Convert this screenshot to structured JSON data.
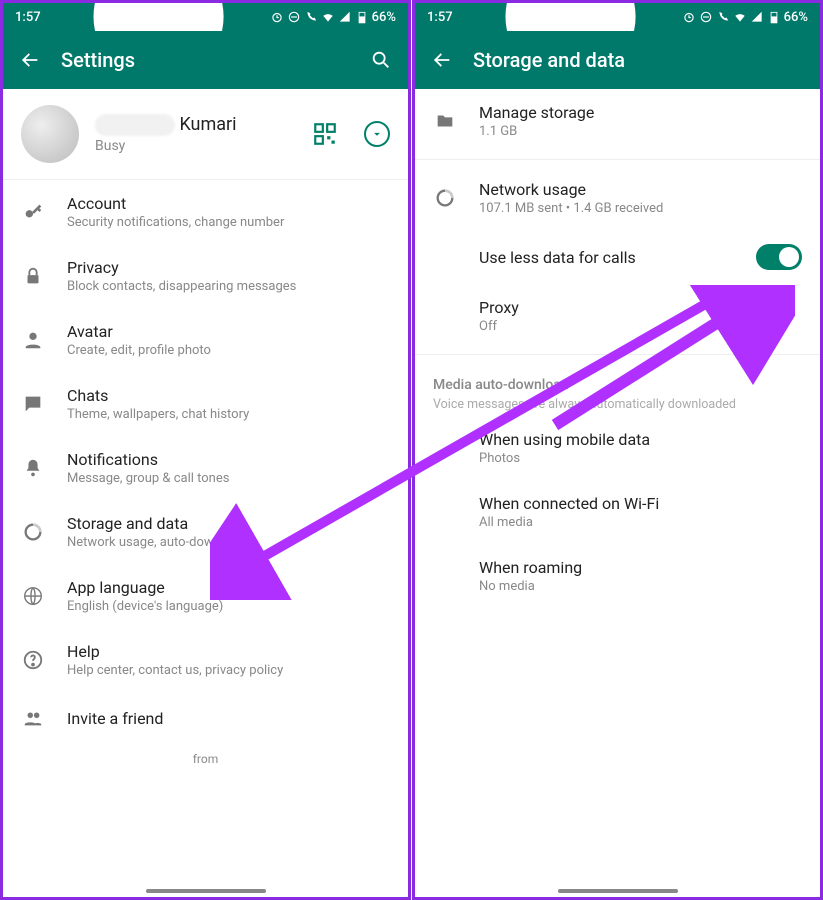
{
  "status": {
    "time": "1:57",
    "battery": "66%"
  },
  "left": {
    "appbar_title": "Settings",
    "profile": {
      "name": "Kumari",
      "status": "Busy"
    },
    "rows": [
      {
        "title": "Account",
        "sub": "Security notifications, change number"
      },
      {
        "title": "Privacy",
        "sub": "Block contacts, disappearing messages"
      },
      {
        "title": "Avatar",
        "sub": "Create, edit, profile photo"
      },
      {
        "title": "Chats",
        "sub": "Theme, wallpapers, chat history"
      },
      {
        "title": "Notifications",
        "sub": "Message, group & call tones"
      },
      {
        "title": "Storage and data",
        "sub": "Network usage, auto-download"
      },
      {
        "title": "App language",
        "sub": "English (device's language)"
      },
      {
        "title": "Help",
        "sub": "Help center, contact us, privacy policy"
      },
      {
        "title": "Invite a friend",
        "sub": ""
      }
    ],
    "footer": "from"
  },
  "right": {
    "appbar_title": "Storage and data",
    "storage": {
      "title": "Manage storage",
      "sub": "1.1 GB"
    },
    "network": {
      "title": "Network usage",
      "sub": "107.1 MB sent • 1.4 GB received"
    },
    "useless": {
      "title": "Use less data for calls",
      "on": true
    },
    "proxy": {
      "title": "Proxy",
      "sub": "Off"
    },
    "section": {
      "title": "Media auto-download",
      "sub": "Voice messages are always automatically downloaded"
    },
    "mobile": {
      "title": "When using mobile data",
      "sub": "Photos"
    },
    "wifi": {
      "title": "When connected on Wi-Fi",
      "sub": "All media"
    },
    "roaming": {
      "title": "When roaming",
      "sub": "No media"
    }
  }
}
